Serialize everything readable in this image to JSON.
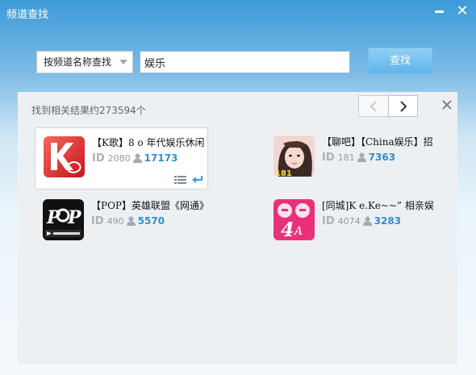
{
  "window": {
    "title": "频道查找",
    "minimize_label": "",
    "close_label": "✕"
  },
  "search": {
    "mode_selected": "按频道名称查找",
    "query_value": "娱乐",
    "button_label": "查找"
  },
  "results": {
    "count_text": "找到相关结果约273594个",
    "id_label": "ID",
    "items": [
      {
        "name": "【K歌】8 o 年代娱乐休闲",
        "id": "2080",
        "members": "17173",
        "selected": true,
        "thumb": "k80"
      },
      {
        "name": "【聊吧】【China娱乐】招",
        "id": "181",
        "members": "7363",
        "selected": false,
        "thumb": "girl-181"
      },
      {
        "name": "【POP】英雄联盟《网通》",
        "id": "490",
        "members": "5570",
        "selected": false,
        "thumb": "pop-lol"
      },
      {
        "name": "[同城]K e.Ke~~” 相亲娱",
        "id": "4074",
        "members": "3283",
        "selected": false,
        "thumb": "xiangqin-4a"
      }
    ]
  },
  "colors": {
    "accent_blue": "#2e8ed8",
    "titlebar_blue": "#3d9ad8",
    "panel_bg": "#edf0f3"
  }
}
